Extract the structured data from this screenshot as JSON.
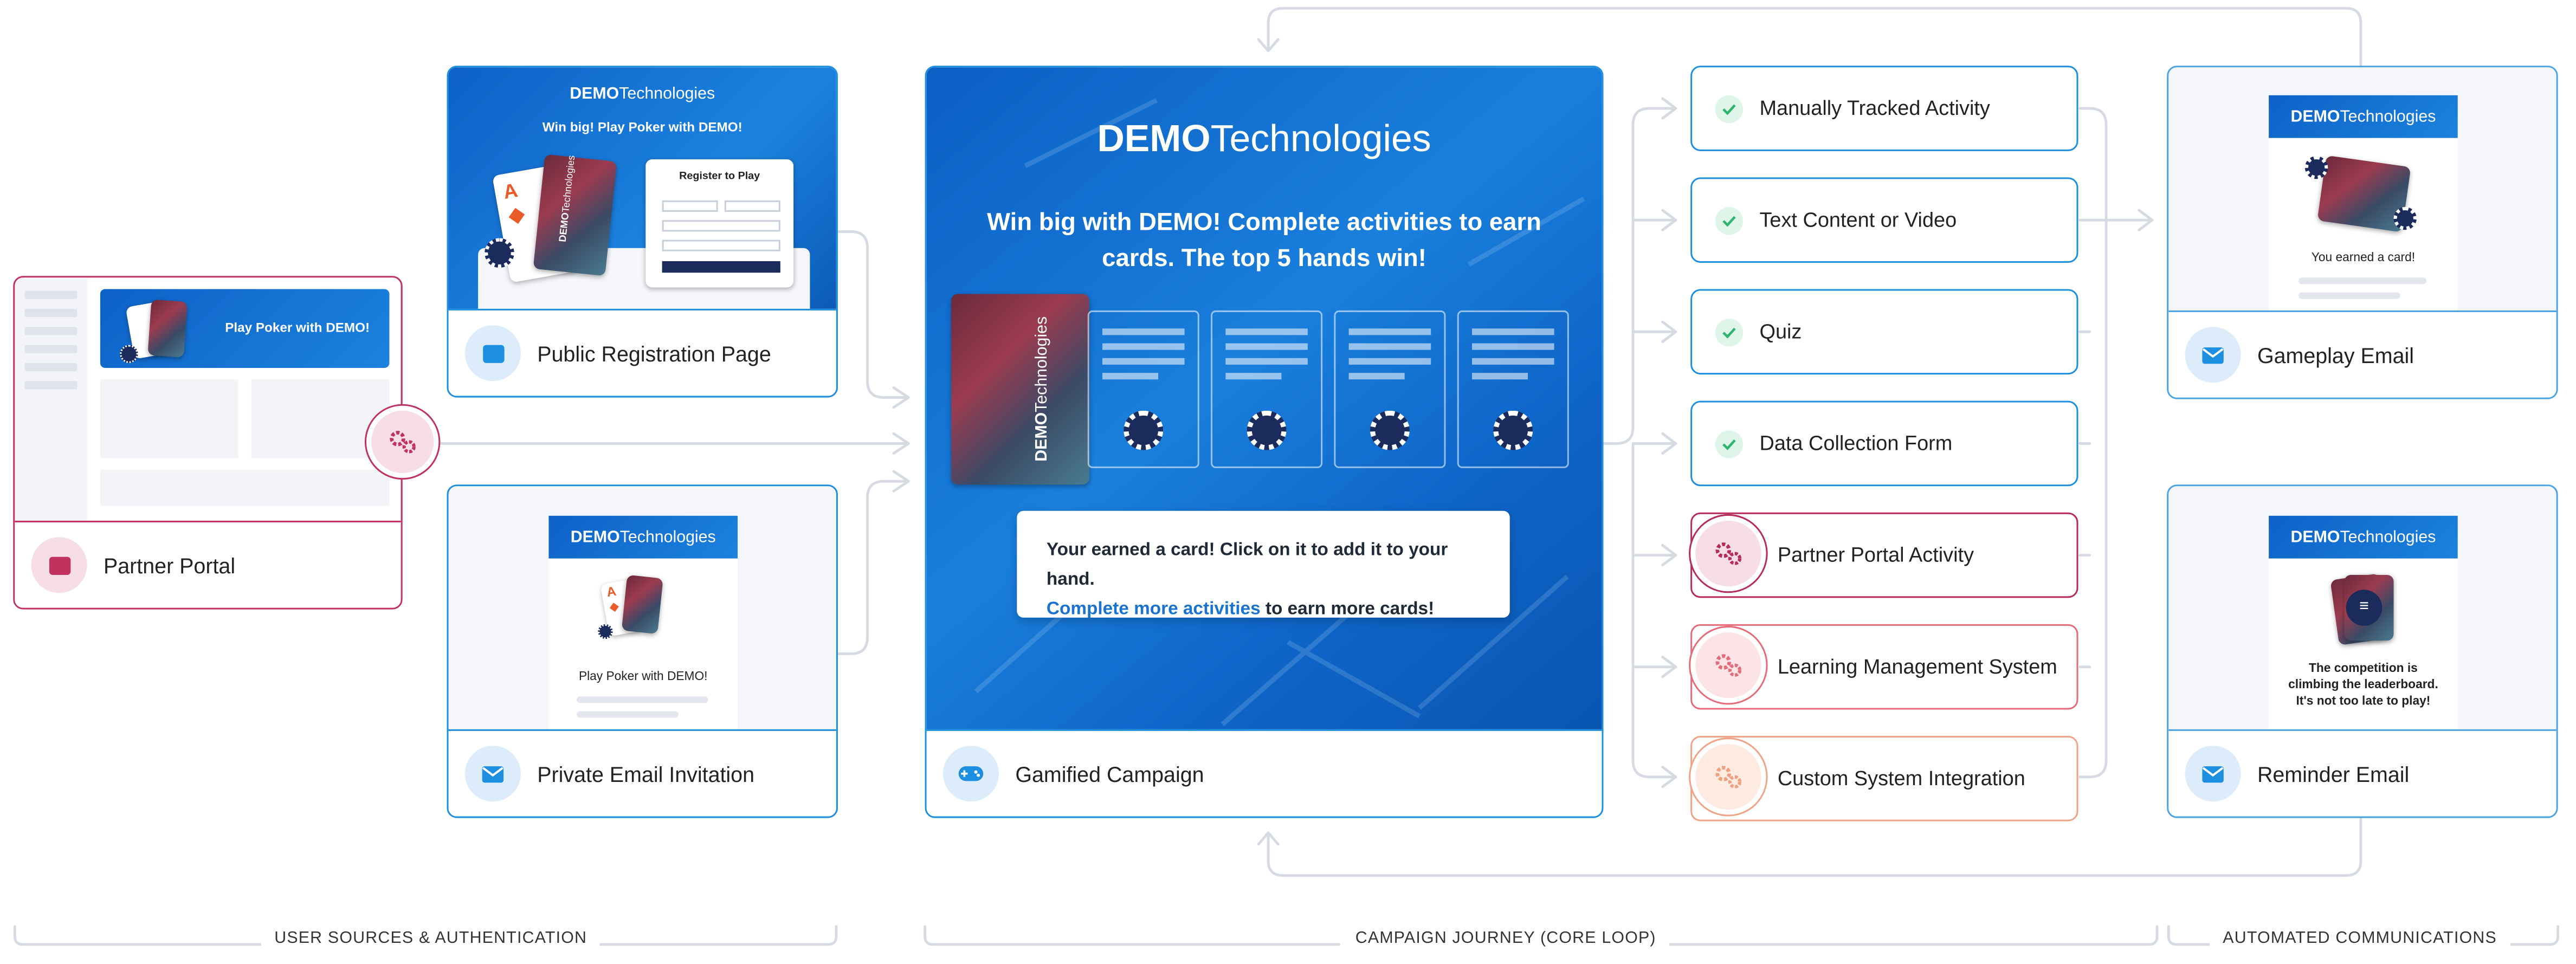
{
  "brand": {
    "bold": "DEMO",
    "rest": "Technologies"
  },
  "colors": {
    "primary": "#1d8fe0",
    "partner": "#c2325f",
    "lms": "#e66a78",
    "custom": "#f2a285",
    "navy": "#1b2b5c"
  },
  "partner_portal": {
    "banner": "Play Poker with DEMO!",
    "label": "Partner Portal",
    "icon": "portal-window-icon"
  },
  "public_registration": {
    "headline": "Win big! Play Poker with DEMO!",
    "form_title": "Register to Play",
    "label": "Public Registration Page",
    "icon": "browser-window-icon"
  },
  "private_invitation": {
    "text": "Play Poker with DEMO!",
    "label": "Private Email Invitation",
    "icon": "envelope-icon"
  },
  "campaign": {
    "headline": "Win big with DEMO! Complete activities to earn cards. The top 5 hands win!",
    "notice_line1": "Your earned a card! Click on it to add it to your hand.",
    "notice_link": "Complete more activities",
    "notice_rest": " to earn more cards!",
    "label": "Gamified Campaign",
    "icon": "gamepad-icon"
  },
  "activities": [
    {
      "label": "Manually Tracked Activity",
      "kind": "check"
    },
    {
      "label": "Text Content or Video",
      "kind": "check"
    },
    {
      "label": "Quiz",
      "kind": "check"
    },
    {
      "label": "Data Collection Form",
      "kind": "check"
    },
    {
      "label": "Partner Portal Activity",
      "kind": "gear"
    },
    {
      "label": "Learning Management System",
      "kind": "gear"
    },
    {
      "label": "Custom System Integration",
      "kind": "gear"
    }
  ],
  "gameplay_email": {
    "text": "You earned a card!",
    "label": "Gameplay Email",
    "icon": "envelope-icon"
  },
  "reminder_email": {
    "text1": "The competition is",
    "text2": "climbing the leaderboard.",
    "text3": "It's not too late to play!",
    "label": "Reminder Email",
    "icon": "envelope-icon"
  },
  "sections": {
    "s1": "USER SOURCES & AUTHENTICATION",
    "s2": "CAMPAIGN JOURNEY (CORE LOOP)",
    "s3": "AUTOMATED COMMUNICATIONS"
  }
}
